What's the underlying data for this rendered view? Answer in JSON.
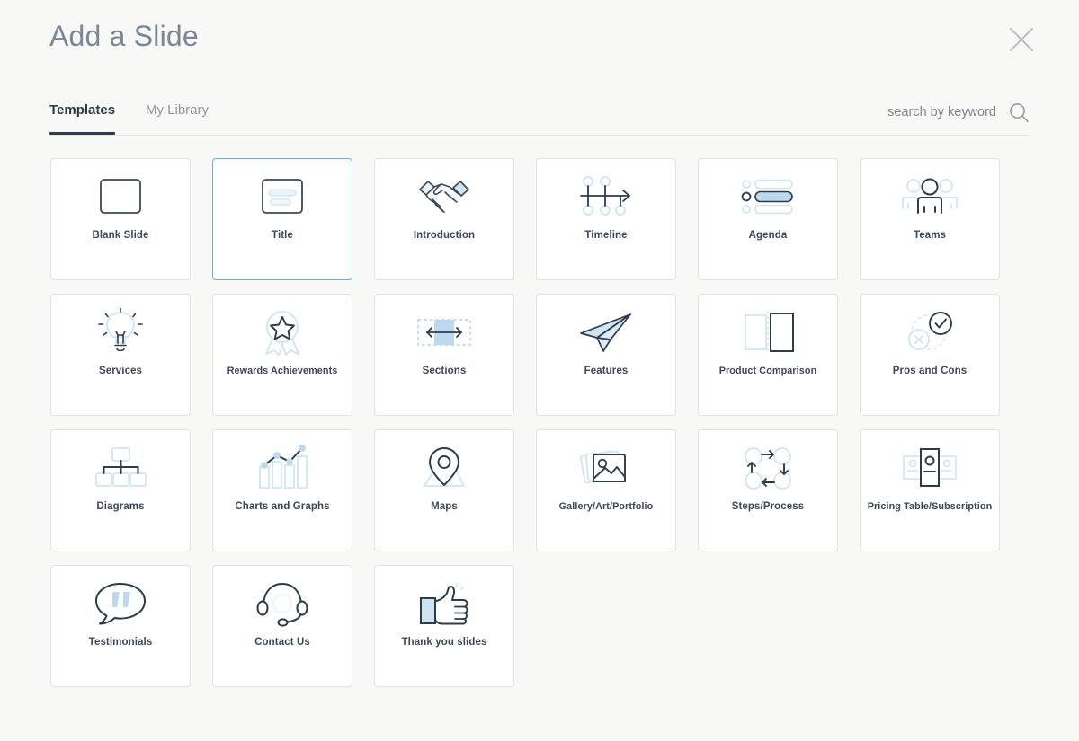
{
  "header": {
    "title": "Add a Slide",
    "close_icon": "close-icon"
  },
  "tabs": [
    {
      "label": "Templates",
      "active": true
    },
    {
      "label": "My Library",
      "active": false
    }
  ],
  "search": {
    "placeholder": "search by keyword",
    "value": "",
    "icon": "search-icon"
  },
  "colors": {
    "background": "#f8f9f7",
    "card_background": "#ffffff",
    "card_border": "#dfe3e1",
    "selected_border": "#68b0d8",
    "accent_light_blue": "#cfe4f2",
    "icon_dark": "#2e3b49",
    "label_text": "#3c4858",
    "title_text": "#7b8794",
    "tab_active": "#2e3b49",
    "tab_inactive": "#8e979e"
  },
  "templates": [
    {
      "label": "Blank Slide",
      "icon": "blank-slide-icon",
      "selected": false
    },
    {
      "label": "Title",
      "icon": "title-icon",
      "selected": true
    },
    {
      "label": "Introduction",
      "icon": "handshake-icon",
      "selected": false
    },
    {
      "label": "Timeline",
      "icon": "timeline-icon",
      "selected": false
    },
    {
      "label": "Agenda",
      "icon": "agenda-list-icon",
      "selected": false
    },
    {
      "label": "Teams",
      "icon": "teams-people-icon",
      "selected": false
    },
    {
      "label": "Services",
      "icon": "lightbulb-icon",
      "selected": false
    },
    {
      "label": "Rewards Achievements",
      "icon": "award-ribbon-icon",
      "selected": false
    },
    {
      "label": "Sections",
      "icon": "sections-arrow-icon",
      "selected": false
    },
    {
      "label": "Features",
      "icon": "paper-plane-icon",
      "selected": false
    },
    {
      "label": "Product Comparison",
      "icon": "compare-panels-icon",
      "selected": false
    },
    {
      "label": "Pros and Cons",
      "icon": "check-x-circles-icon",
      "selected": false
    },
    {
      "label": "Diagrams",
      "icon": "org-chart-icon",
      "selected": false
    },
    {
      "label": "Charts and Graphs",
      "icon": "bar-line-chart-icon",
      "selected": false
    },
    {
      "label": "Maps",
      "icon": "map-pin-icon",
      "selected": false
    },
    {
      "label": "Gallery/Art/Portfolio",
      "icon": "photo-stack-icon",
      "selected": false
    },
    {
      "label": "Steps/Process",
      "icon": "process-cycle-icon",
      "selected": false
    },
    {
      "label": "Pricing Table/Subscription",
      "icon": "pricing-cards-icon",
      "selected": false
    },
    {
      "label": "Testimonials",
      "icon": "quote-bubble-icon",
      "selected": false
    },
    {
      "label": "Contact Us",
      "icon": "headset-icon",
      "selected": false
    },
    {
      "label": "Thank you slides",
      "icon": "thumbs-up-icon",
      "selected": false
    }
  ]
}
